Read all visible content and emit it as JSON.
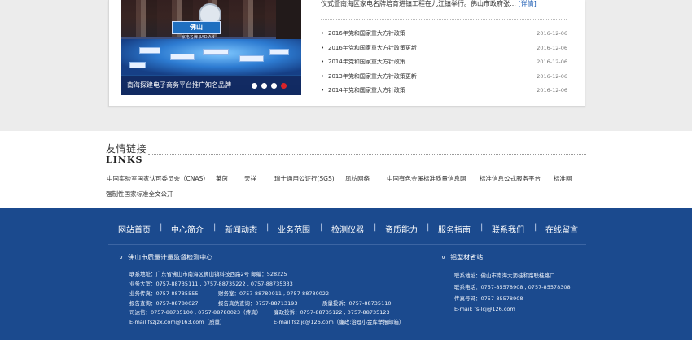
{
  "news": {
    "summary_text": "仪式暨南海区家电名牌培育进镇工程在九江镇举行。佛山市政府张…",
    "more_label": "[详情]",
    "caption": "南海探建电子商务平台推广知名品牌",
    "image_logo_text": "佛山",
    "image_logo_sub": "家电名牌 JIADIAN",
    "items": [
      {
        "title": "2016年党和国家重大方针政策",
        "date": "2016-12-06"
      },
      {
        "title": "2016年党和国家重大方针政策更新",
        "date": "2016-12-06"
      },
      {
        "title": "2014年党和国家重大方针政策",
        "date": "2016-12-06"
      },
      {
        "title": "2013年党和国家重大方针政策更新",
        "date": "2016-12-06"
      },
      {
        "title": "2014年党和国家重大方针政策",
        "date": "2016-12-06"
      }
    ]
  },
  "links": {
    "title_cn": "友情链接",
    "title_en": "LINKS",
    "row1": [
      "中国实验室国家认可委员会（CNAS）",
      "莱茵",
      "天祥",
      "瑞士通用公证行(SGS)",
      "凤妨网络",
      "中国有色金属标准质量信息网",
      "标准信息公式服务平台",
      "标准网"
    ],
    "row2": [
      "强制性国家标准全文公开"
    ]
  },
  "footer": {
    "nav": [
      "网站首页",
      "中心简介",
      "新闻动态",
      "业务范围",
      "检测仪器",
      "资质能力",
      "服务指南",
      "联系我们",
      "在线留言"
    ],
    "sep": "|",
    "left_title": "佛山市质量计量监督检测中心",
    "left_lines": [
      "联系地址：广东省佛山市南海区狮山镇科技西路2号 邮编：528225",
      "业务大室：0757-88735111 , 0757-88735222 , 0757-88735333",
      "业务传真：0757-88735555",
      "报告查询：0757-88780027",
      "司达信：0757-88735100 , 0757-88780023（传真）",
      "E-mail:fszjzx.com@163.com（质量）"
    ],
    "left_col2": [
      "财务室：0757-88780011 , 0757-88780022",
      "报告真伪查询：0757-88713193",
      "廉政投诉：0757-88735122 , 0757-88735123",
      "E-mail:fszjjc@126.com（廉政:治理小金库举报邮箱）"
    ],
    "left_col3": [
      "质量投诉：0757-88735110"
    ],
    "right_title": "铝型材省站",
    "right_lines": [
      "联系地址：佛山市南海大沥桂和路联桂路口",
      "联系电话：0757-85578908 , 0757-85578308",
      "传真号码：0757-85578908",
      "E-mail: fs-lcj@126.com"
    ]
  }
}
